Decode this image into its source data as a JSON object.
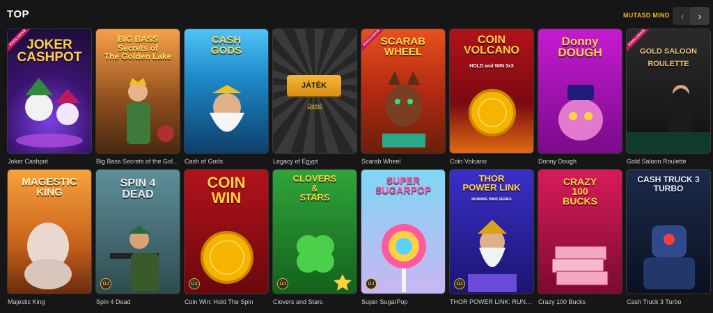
{
  "section": {
    "title": "TOP",
    "show_all": "MUTASD MIND"
  },
  "nav": {
    "prev": "‹",
    "next": "›"
  },
  "tiles": [
    {
      "caption": "Joker Cashpot",
      "art": "JOKER\nCASHPOT",
      "badge": "EXCLUSIVE"
    },
    {
      "caption": "Big Bass Secrets of the Golden ...",
      "art": "BIG BASS\nSecrets of\nThe Golden Lake"
    },
    {
      "caption": "Cash of Gods",
      "art": "CASH\nGODS"
    },
    {
      "caption": "Legacy of Egypt",
      "play": "JÁTÉK",
      "demo": "Demó"
    },
    {
      "caption": "Scarab Wheel",
      "art": "SCARAB\nWHEEL",
      "badge": "EXCLUSIVE"
    },
    {
      "caption": "Coin Volcano",
      "art": "COIN\nVOLCANO",
      "sub": "HOLD and WIN 3x3"
    },
    {
      "caption": "Donny Dough",
      "art": "Donny\nDOUGH"
    },
    {
      "caption": "Gold Saloon Roulette",
      "art": "GOLD SALOON\nROULETTE",
      "badge": "EXCLUSIVE"
    },
    {
      "caption": "Majestic King",
      "art": "MAGESTIC\nKING"
    },
    {
      "caption": "Spin 4 Dead",
      "art": "SPIN 4\nDEAD",
      "uj": "ÚJ"
    },
    {
      "caption": "Coin Win: Hold The Spin",
      "art": "COIN\nWIN",
      "uj": "ÚJ"
    },
    {
      "caption": "Clovers and Stars",
      "art": "CLOVERS\n&\nSTARS",
      "uj": "ÚJ"
    },
    {
      "caption": "Super SugarPop",
      "art": "SUPER\nSUGARPOP",
      "uj": "ÚJ"
    },
    {
      "caption": "THOR POWER LINK: RUNNING ...",
      "art": "THOR\nPOWER LINK",
      "sub": "RUNNING WINS SERIES",
      "uj": "ÚJ"
    },
    {
      "caption": "Crazy 100 Bucks",
      "art": "CRAZY\n100\nBUCKS"
    },
    {
      "caption": "Cash Truck 3 Turbo",
      "art": "CASH TRUCK 3\nTURBO"
    }
  ],
  "colors": {
    "accent": "#f0b429",
    "background": "#161616"
  }
}
